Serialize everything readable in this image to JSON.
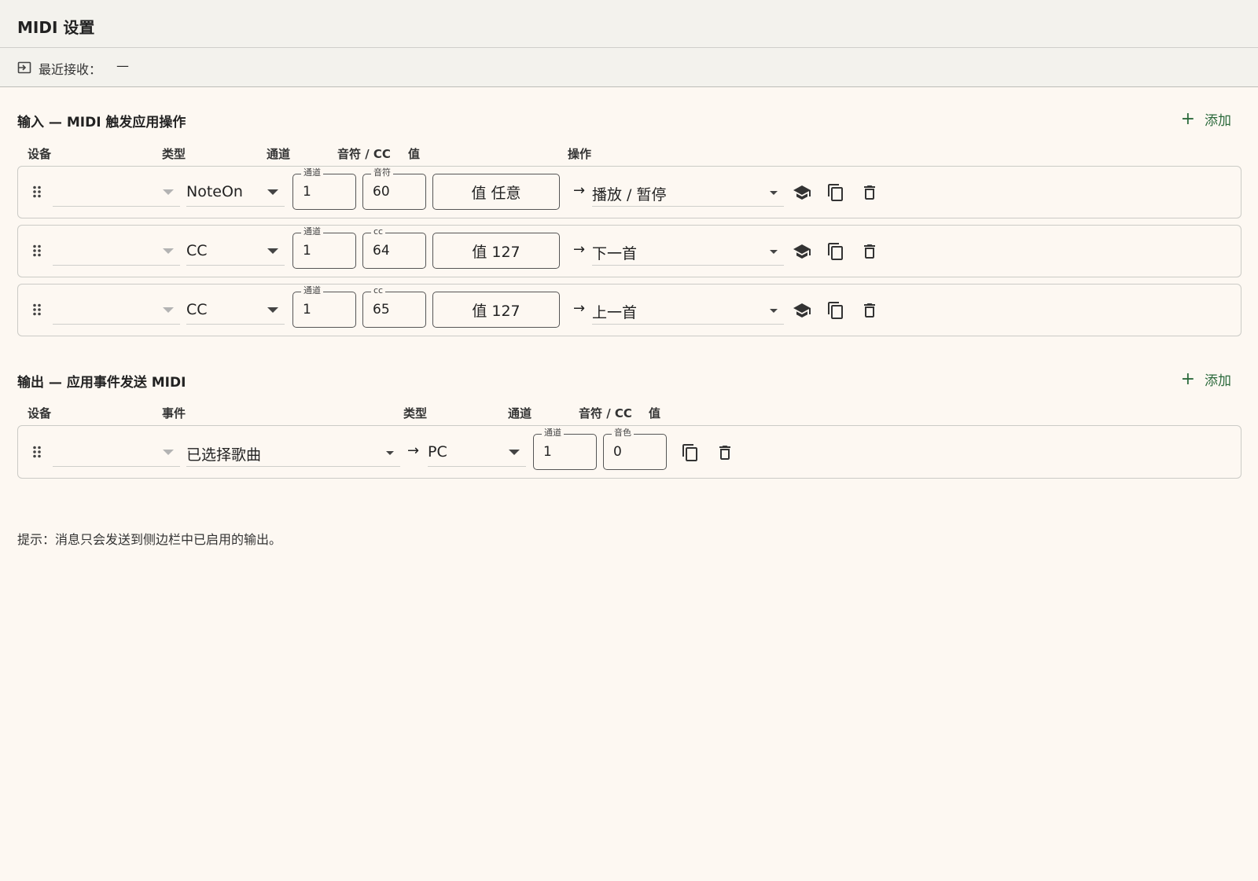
{
  "header": {
    "title": "MIDI 设置"
  },
  "received": {
    "icon": "input-icon",
    "label": "最近接收：",
    "value": "—"
  },
  "input_section": {
    "title": "输入 — MIDI 触发应用操作",
    "add_label": "添加",
    "columns": {
      "device": "设备",
      "type": "类型",
      "channel": "通道",
      "note_cc": "音符 / CC",
      "value": "值",
      "action": "操作"
    },
    "rows": [
      {
        "device": "",
        "type": "NoteOn",
        "channel_label": "通道",
        "channel": "1",
        "num_label": "音符",
        "num": "60",
        "value_btn": "值 任意",
        "action": "播放 / 暂停"
      },
      {
        "device": "",
        "type": "CC",
        "channel_label": "通道",
        "channel": "1",
        "num_label": "cc",
        "num": "64",
        "value_btn": "值 127",
        "action": "下一首"
      },
      {
        "device": "",
        "type": "CC",
        "channel_label": "通道",
        "channel": "1",
        "num_label": "cc",
        "num": "65",
        "value_btn": "值 127",
        "action": "上一首"
      }
    ]
  },
  "output_section": {
    "title": "输出 — 应用事件发送 MIDI",
    "add_label": "添加",
    "columns": {
      "device": "设备",
      "event": "事件",
      "type": "类型",
      "channel": "通道",
      "note_cc": "音符 / CC",
      "value": "值"
    },
    "rows": [
      {
        "device": "",
        "event": "已选择歌曲",
        "type": "PC",
        "channel_label": "通道",
        "channel": "1",
        "num_label": "音色",
        "num": "0"
      }
    ]
  },
  "hint": "提示：消息只会发送到侧边栏中已启用的输出。",
  "colors": {
    "accent": "#2c6a3c",
    "background": "#fdf8f2",
    "header": "#f3f2ed"
  }
}
